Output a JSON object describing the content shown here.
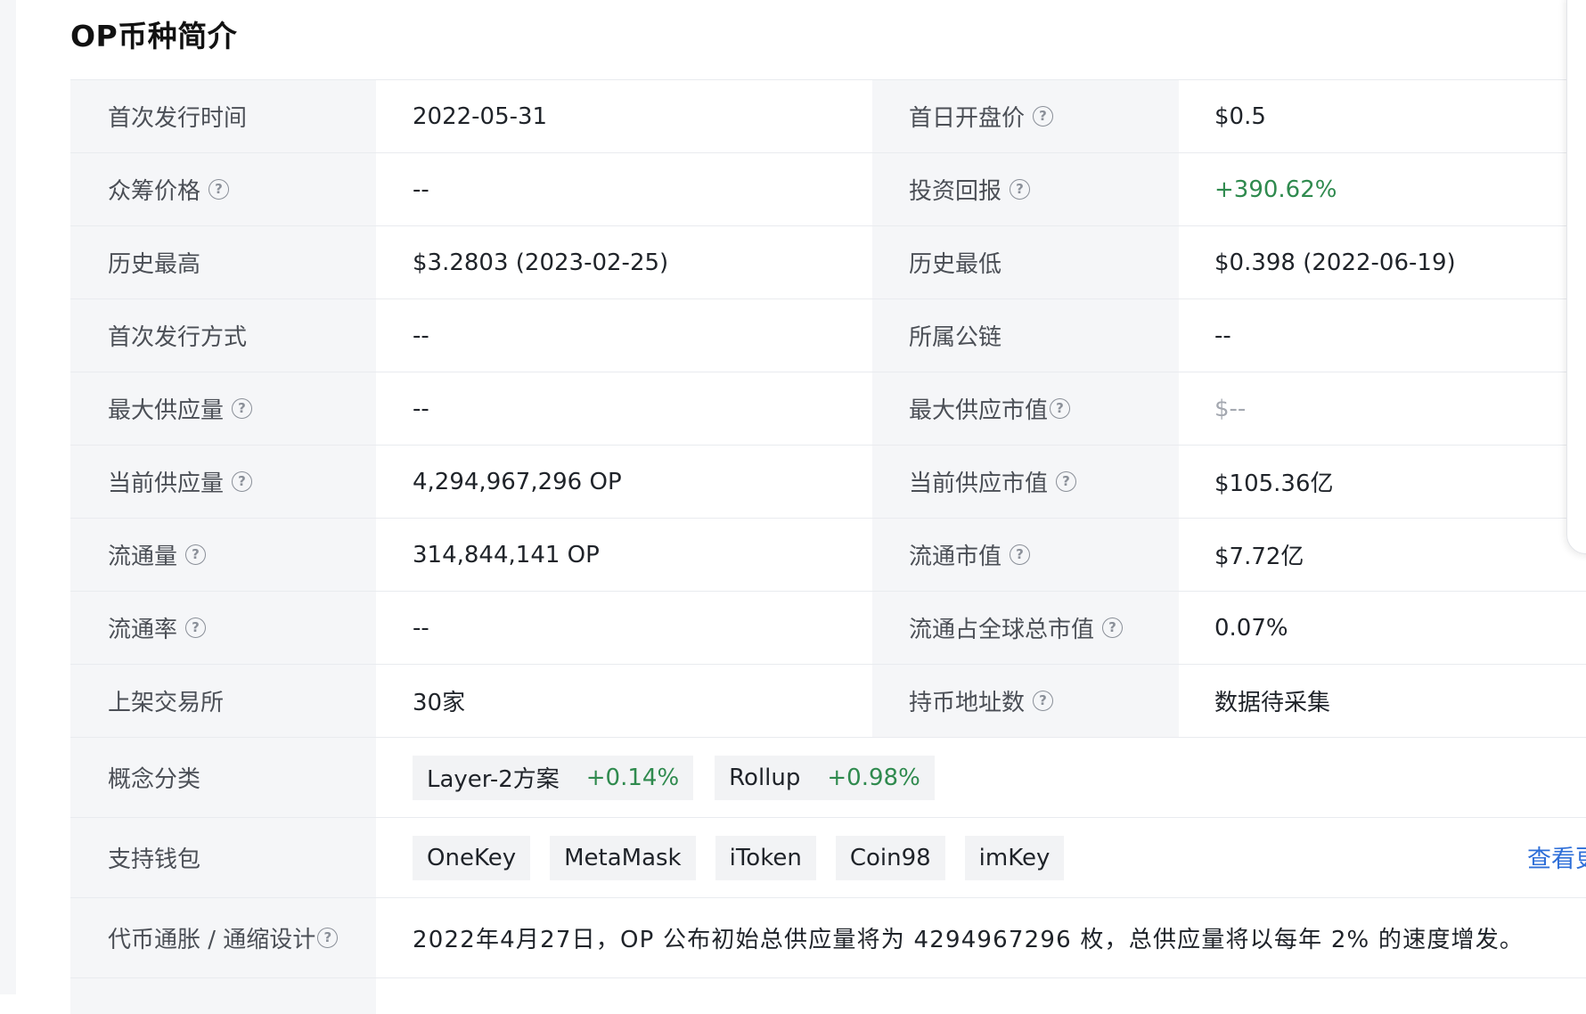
{
  "title": "OP币种简介",
  "rows": [
    {
      "l1": "首次发行时间",
      "h1": false,
      "v1": "2022-05-31",
      "l2": "首日开盘价",
      "h2": true,
      "v2": "$0.5",
      "v2_style": ""
    },
    {
      "l1": "众筹价格",
      "h1": true,
      "v1": "--",
      "l2": "投资回报",
      "h2": true,
      "v2": "+390.62%",
      "v2_style": "green"
    },
    {
      "l1": "历史最高",
      "h1": false,
      "v1": "$3.2803 (2023-02-25)",
      "l2": "历史最低",
      "h2": false,
      "v2": "$0.398 (2022-06-19)",
      "v2_style": ""
    },
    {
      "l1": "首次发行方式",
      "h1": false,
      "v1": "--",
      "l2": "所属公链",
      "h2": false,
      "v2": "--",
      "v2_style": ""
    },
    {
      "l1": "最大供应量",
      "h1": true,
      "v1": "--",
      "l2": "最大供应市值",
      "h2": true,
      "v2": "$--",
      "v2_style": "muted"
    },
    {
      "l1": "当前供应量",
      "h1": true,
      "v1": "4,294,967,296 OP",
      "l2": "当前供应市值",
      "h2": true,
      "v2": "$105.36亿",
      "v2_style": ""
    },
    {
      "l1": "流通量",
      "h1": true,
      "v1": "314,844,141 OP",
      "l2": "流通市值",
      "h2": true,
      "v2": "$7.72亿",
      "v2_style": ""
    },
    {
      "l1": "流通率",
      "h1": true,
      "v1": "--",
      "l2": "流通占全球总市值",
      "h2": true,
      "v2": "0.07%",
      "v2_style": ""
    },
    {
      "l1": "上架交易所",
      "h1": false,
      "v1": "30家",
      "l2": "持币地址数",
      "h2": true,
      "v2": "数据待采集",
      "v2_style": ""
    }
  ],
  "concepts": {
    "label": "概念分类",
    "tags": [
      {
        "name": "Layer-2方案",
        "change": "+0.14%"
      },
      {
        "name": "Rollup",
        "change": "+0.98%"
      }
    ]
  },
  "wallets": {
    "label": "支持钱包",
    "items": [
      "OneKey",
      "MetaMask",
      "iToken",
      "Coin98",
      "imKey"
    ],
    "more_link": "查看更多"
  },
  "inflation": {
    "label": "代币通胀 / 通缩设计",
    "text": "2022年4月27日，OP 公布初始总供应量将为 4294967296 枚，总供应量将以每年 2% 的速度增发。"
  },
  "help_glyph": "?"
}
